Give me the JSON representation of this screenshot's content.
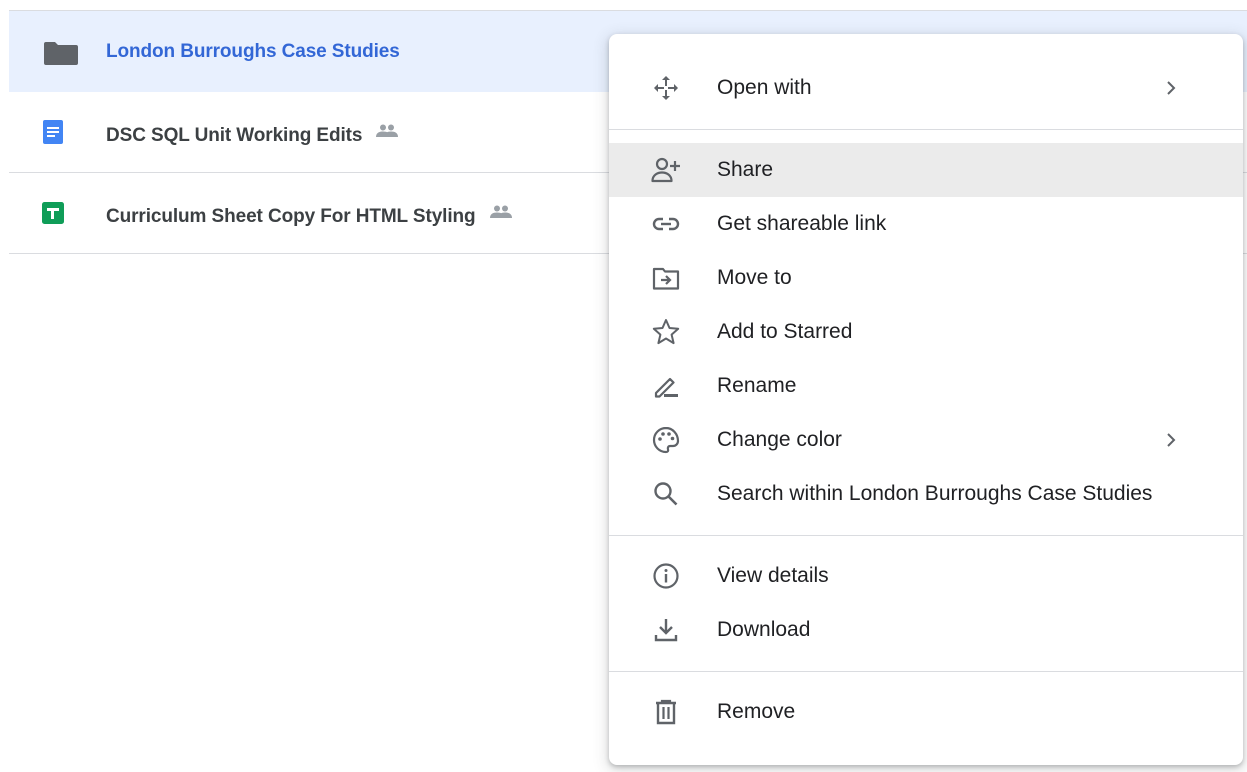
{
  "files": [
    {
      "name": "London Burroughs Case Studies",
      "icon": "folder-icon",
      "selected": true,
      "shared": false
    },
    {
      "name": "DSC SQL Unit Working Edits",
      "icon": "google-docs-icon",
      "selected": false,
      "shared": true
    },
    {
      "name": "Curriculum Sheet Copy For HTML Styling",
      "icon": "google-sheets-icon",
      "selected": false,
      "shared": true
    }
  ],
  "context_menu": {
    "items": [
      {
        "label": "Open with",
        "icon": "open-with-icon",
        "submenu": true
      },
      {
        "label": "Share",
        "icon": "share-icon",
        "hovered": true
      },
      {
        "label": "Get shareable link",
        "icon": "link-icon"
      },
      {
        "label": "Move to",
        "icon": "move-to-icon"
      },
      {
        "label": "Add to Starred",
        "icon": "star-icon"
      },
      {
        "label": "Rename",
        "icon": "rename-icon"
      },
      {
        "label": "Change color",
        "icon": "palette-icon",
        "submenu": true
      },
      {
        "label": "Search within London Burroughs Case Studies",
        "icon": "search-icon"
      },
      {
        "label": "View details",
        "icon": "info-icon"
      },
      {
        "label": "Download",
        "icon": "download-icon"
      },
      {
        "label": "Remove",
        "icon": "trash-icon"
      }
    ]
  },
  "colors": {
    "selected_row_bg": "#e8f0fe",
    "selected_text": "#3367d6",
    "docs_blue": "#4285f4",
    "sheets_green": "#0f9d58",
    "icon_gray": "#5f6368",
    "hover_bg": "#ebebeb"
  }
}
